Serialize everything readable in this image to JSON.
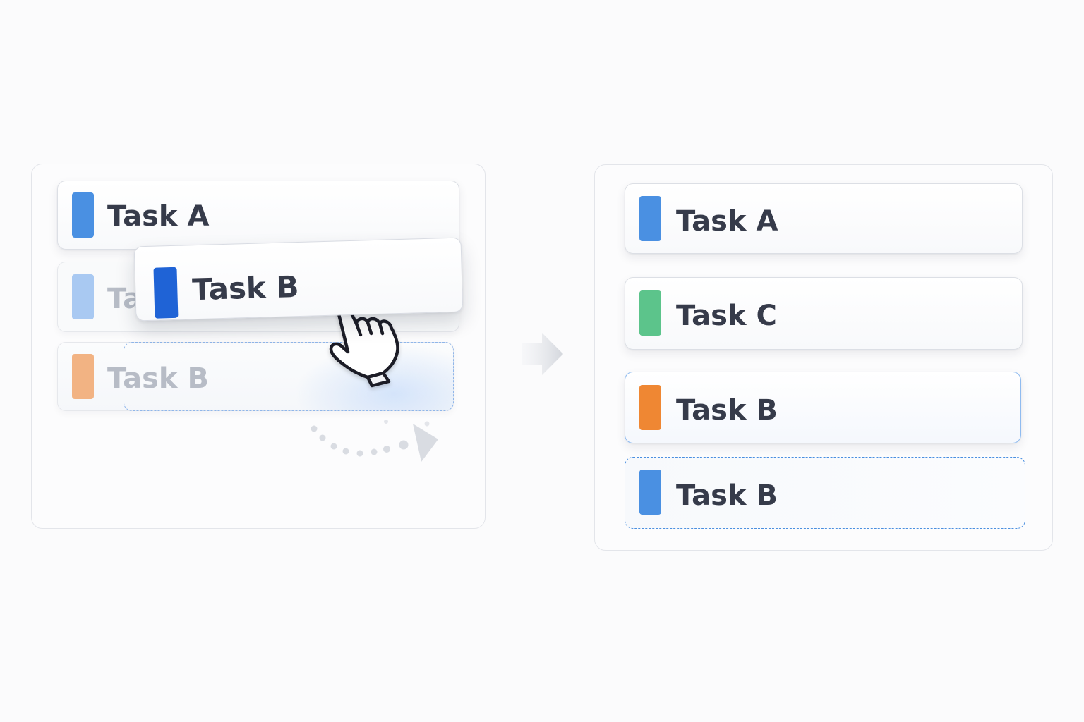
{
  "colors": {
    "blue": "#4a90e2",
    "blue_light": "#a9c9f2",
    "blue_dark": "#1f63d6",
    "orange": "#ef8733",
    "orange_light": "#f2b383",
    "green": "#5cc48b",
    "text": "#363b4a",
    "text_faded": "#b7bcc6"
  },
  "before": {
    "items": [
      {
        "label": "Task A",
        "color": "blue"
      },
      {
        "label": "Ta",
        "color": "blue_light",
        "state": "faded"
      },
      {
        "label": "Task B",
        "color": "orange_light",
        "state": "drop-target"
      }
    ],
    "dragged": {
      "label": "Task B",
      "color": "blue_dark"
    }
  },
  "after": {
    "items": [
      {
        "label": "Task A",
        "color": "blue"
      },
      {
        "label": "Task C",
        "color": "green"
      },
      {
        "label": "Task B",
        "color": "orange",
        "state": "highlighted"
      },
      {
        "label": "Task B",
        "color": "blue",
        "state": "dashed-placeholder"
      }
    ]
  },
  "icons": {
    "cursor": "hand-pointer-icon",
    "arrow": "arrow-right-icon",
    "motion": "curved-dotted-arrow-icon"
  }
}
